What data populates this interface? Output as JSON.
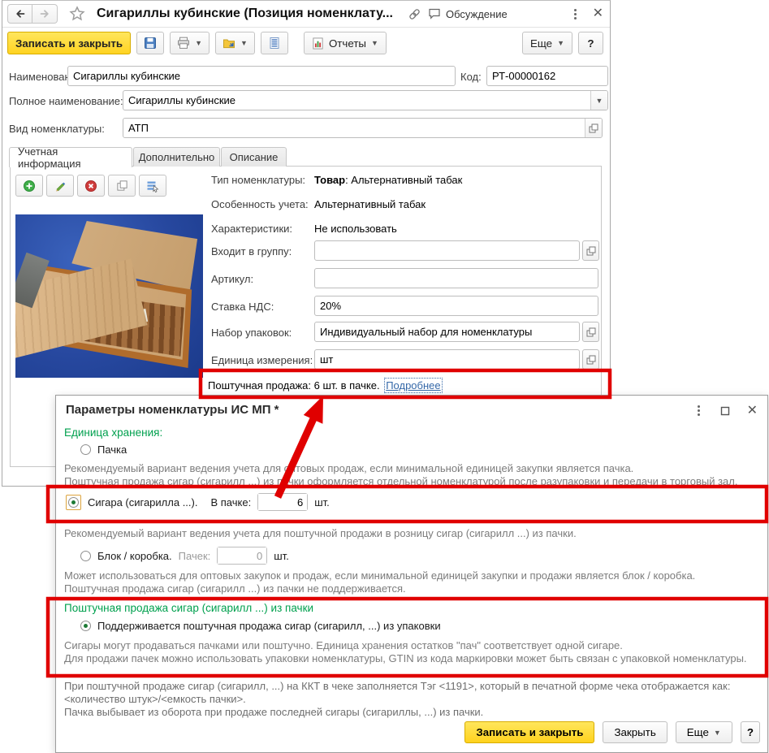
{
  "main_window": {
    "title": "Сигариллы кубинские (Позиция номенклату...",
    "titlebar": {
      "discussion": "Обсуждение"
    },
    "toolbar": {
      "save_and_close": "Записать и закрыть",
      "reports": "Отчеты",
      "more": "Еще",
      "help": "?"
    },
    "header_fields": {
      "name_label": "Наименование:",
      "name_value": "Сигариллы кубинские",
      "code_label": "Код:",
      "code_value": "РТ-00000162",
      "full_name_label": "Полное наименование:",
      "full_name_value": "Сигариллы кубинские",
      "kind_label": "Вид номенклатуры:",
      "kind_value": "АТП"
    },
    "tabs": [
      {
        "label": "Учетная информация"
      },
      {
        "label": "Дополнительно"
      },
      {
        "label": "Описание"
      }
    ],
    "details": {
      "nomenclature_type_label": "Тип номенклатуры:",
      "nomenclature_type_bold": "Товар",
      "nomenclature_type_rest": ": Альтернативный табак",
      "accounting_label": "Особенность учета:",
      "accounting_value": "Альтернативный табак",
      "characteristics_label": "Характеристики:",
      "characteristics_value": "Не использовать",
      "group_label": "Входит в группу:",
      "article_label": "Артикул:",
      "vat_label": "Ставка НДС:",
      "vat_value": "20%",
      "package_set_label": "Набор упаковок:",
      "package_set_value": "Индивидуальный набор для номенклатуры",
      "unit_label": "Единица измерения:",
      "unit_value": "шт",
      "piece_sale_text": "Поштучная продажа: 6 шт. в пачке.",
      "piece_sale_link": "Подробнее"
    }
  },
  "dialog": {
    "title": "Параметры номенклатуры ИС МП *",
    "storage_header": "Единица хранения:",
    "pack_option": "Пачка",
    "pack_desc": [
      "Рекомендуемый вариант ведения учета для оптовых продаж, если минимальной единицей закупки является пачка.",
      "Поштучная продажа сигар (сигарилл ...) из пачки оформляется отдельной номенклатурой после разупаковки и передачи в торговый зал."
    ],
    "cigar_option": "Сигара (сигарилла ...).",
    "in_pack_label": "В пачке:",
    "in_pack_value": "6",
    "pcs_label": "шт.",
    "cigar_desc": "Рекомендуемый вариант ведения учета для поштучной продажи в розницу сигар (сигарилл ...) из пачки.",
    "block_option": "Блок / коробка.",
    "packs_label": "Пачек:",
    "packs_value": "0",
    "block_desc": [
      "Может использоваться для оптовых закупок и продаж, если минимальной единицей закупки и продажи является блок / коробка.",
      "Поштучная продажа сигар (сигарилл ...) из пачки не поддерживается."
    ],
    "piece_header": "Поштучная продажа сигар (сигарилл ...) из пачки",
    "piece_option": "Поддерживается поштучная продажа сигар (сигарилл, ...) из упаковки",
    "piece_desc": [
      "Сигары могут продаваться пачками или поштучно. Единица хранения остатков \"пач\" соответствует одной сигаре.",
      "Для продажи пачек можно использовать упаковки номенклатуры, GTIN из кода маркировки может быть связан с упаковкой номенклатуры."
    ],
    "footer_note": [
      "При поштучной продаже сигар (сигарилл, ...) на ККТ в чеке заполняется Тэг <1191>, который в печатной форме чека отображается как:",
      "<количество штук>/<емкость пачки>.",
      "Пачка выбывает из оборота при продаже последней сигары (сигариллы, ...) из пачки."
    ],
    "buttons": {
      "save_close": "Записать и закрыть",
      "close": "Закрыть",
      "more": "Еще",
      "help": "?"
    }
  },
  "annotations": {
    "color": "#e00000"
  }
}
